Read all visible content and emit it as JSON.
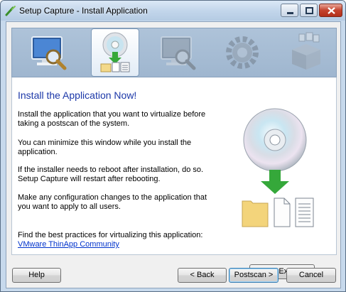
{
  "window": {
    "title": "Setup Capture - Install Application"
  },
  "steps": [
    {
      "icon": "monitor-magnifier-icon",
      "active": false
    },
    {
      "icon": "disc-install-icon",
      "active": true
    },
    {
      "icon": "monitor-scan-icon",
      "active": false
    },
    {
      "icon": "gear-icon",
      "active": false
    },
    {
      "icon": "package-icon",
      "active": false
    }
  ],
  "content": {
    "heading": "Install the Application Now!",
    "paragraphs": [
      "Install the application that you want to virtualize before taking a postscan of the system.",
      "You can minimize this window while you install the application.",
      "If the installer needs to reboot after installation, do so. Setup Capture will restart after rebooting.",
      "Make any configuration changes to the application that you want to apply to all users."
    ],
    "best_practices": "Find the best practices for virtualizing this application:",
    "community_link": "VMware ThinApp Community",
    "ie_button": "Internet Explorer..."
  },
  "buttons": {
    "help": "Help",
    "back": "< Back",
    "postscan": "Postscan >",
    "cancel": "Cancel"
  },
  "colors": {
    "heading": "#1b37a8",
    "link": "#0033cc",
    "arrow_green": "#35a83a"
  }
}
